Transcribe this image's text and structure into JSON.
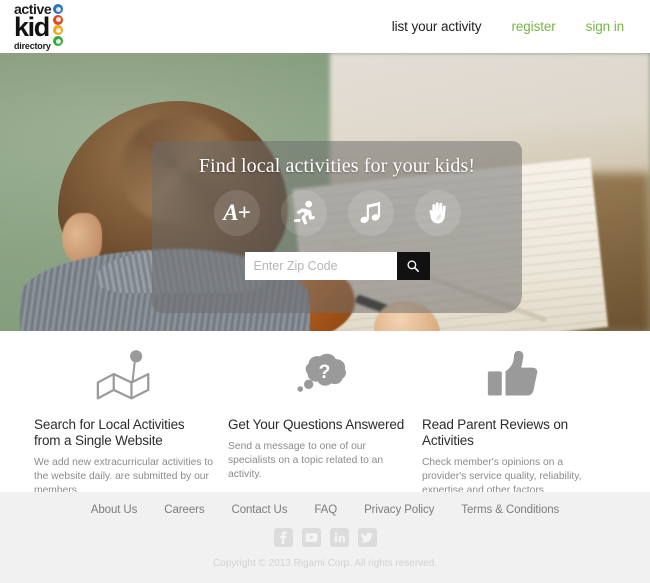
{
  "brand": {
    "line1": "active",
    "line2": "kid",
    "line3": "directory",
    "dot_colors": [
      "#2a72c4",
      "#e0491d",
      "#f0a81c",
      "#35a83b"
    ]
  },
  "nav": {
    "items": [
      {
        "label": "list your activity",
        "style": "dark"
      },
      {
        "label": "register",
        "style": "green"
      },
      {
        "label": "sign in",
        "style": "green"
      }
    ],
    "accent_green": "#78b544"
  },
  "hero": {
    "title": "Find local activities for your kids!",
    "icons": [
      {
        "name": "grade-aplus-icon",
        "glyph": "A+"
      },
      {
        "name": "running-figure-icon",
        "glyph": ""
      },
      {
        "name": "music-note-icon",
        "glyph": ""
      },
      {
        "name": "raised-hand-icon",
        "glyph": ""
      }
    ],
    "search": {
      "placeholder": "Enter Zip Code",
      "value": "",
      "button_icon": "search-icon"
    }
  },
  "features": [
    {
      "icon": "folded-map-pin-icon",
      "title": "Search for Local Activities from a Single Website",
      "text": "We add new extracurricular activities to the website daily. are submitted by our members."
    },
    {
      "icon": "thought-bubble-question-icon",
      "title": "Get Your Questions Answered",
      "text": "Send a message to one of our specialists on a topic related to an activity."
    },
    {
      "icon": "thumbs-up-icon",
      "title": "Read Parent Reviews on Activities",
      "text": "Check member's opinions on a provider's service quality, reliability, expertise and other factors."
    }
  ],
  "footer": {
    "links": [
      "About Us",
      "Careers",
      "Contact Us",
      "FAQ",
      "Privacy Policy",
      "Terms & Conditions"
    ],
    "social": [
      {
        "name": "facebook-icon",
        "glyph": "f"
      },
      {
        "name": "youtube-icon",
        "glyph": "▶"
      },
      {
        "name": "linkedin-icon",
        "glyph": "in"
      },
      {
        "name": "twitter-icon",
        "glyph": "✉"
      }
    ],
    "copyright": "Copyright © 2013 Rigami Corp. All rights reserved."
  }
}
